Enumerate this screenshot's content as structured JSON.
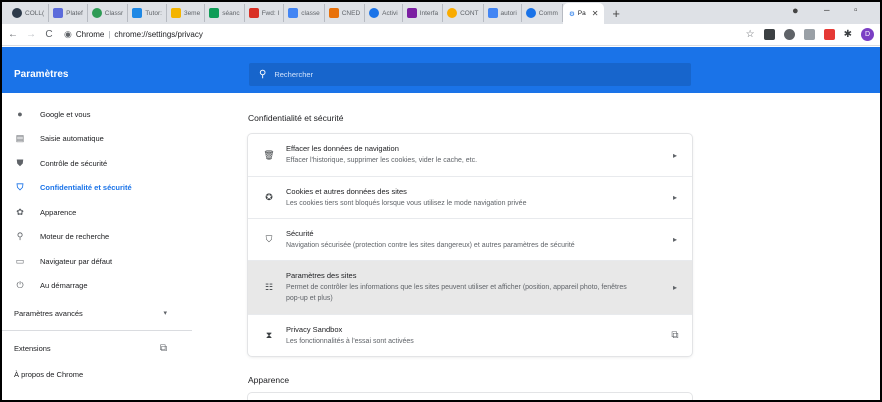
{
  "tabs": [
    {
      "label": "COLL(",
      "color": "#2d3a4a"
    },
    {
      "label": "Platef",
      "color": "#5b6bdb"
    },
    {
      "label": "Classr",
      "color": "#2e9b55"
    },
    {
      "label": "Tutor:",
      "color": "#1e88e5"
    },
    {
      "label": "3eme",
      "color": "#f4b400"
    },
    {
      "label": "séanc",
      "color": "#0f9d58"
    },
    {
      "label": "Fwd: I",
      "color": "#d93025"
    },
    {
      "label": "classe",
      "color": "#4285f4"
    },
    {
      "label": "CNED",
      "color": "#e8710a"
    },
    {
      "label": "Activi",
      "color": "#1a73e8"
    },
    {
      "label": "Interfa",
      "color": "#7b1fa2"
    },
    {
      "label": "CONT",
      "color": "#f9ab00"
    },
    {
      "label": "autori",
      "color": "#4285f4"
    },
    {
      "label": "Comm",
      "color": "#1a73e8"
    }
  ],
  "active_tab": {
    "label": "Pa"
  },
  "address": {
    "site": "Chrome",
    "url": "chrome://settings/privacy"
  },
  "header": {
    "title": "Paramètres",
    "search_placeholder": "Rechercher"
  },
  "profile_initial": "D",
  "sidebar": {
    "items": [
      {
        "label": "Google et vous",
        "icon": "person-icon",
        "glyph": "👤"
      },
      {
        "label": "Saisie automatique",
        "icon": "clipboard-icon",
        "glyph": "▤"
      },
      {
        "label": "Contrôle de sécurité",
        "icon": "shield-check-icon",
        "glyph": "⛊"
      },
      {
        "label": "Confidentialité et sécurité",
        "icon": "shield-icon",
        "glyph": "⛉"
      },
      {
        "label": "Apparence",
        "icon": "palette-icon",
        "glyph": "🎨"
      },
      {
        "label": "Moteur de recherche",
        "icon": "search-icon",
        "glyph": "⚲"
      },
      {
        "label": "Navigateur par défaut",
        "icon": "browser-icon",
        "glyph": "▭"
      },
      {
        "label": "Au démarrage",
        "icon": "power-icon",
        "glyph": "⏻"
      }
    ],
    "advanced": "Paramètres avancés",
    "extensions": "Extensions",
    "about": "À propos de Chrome"
  },
  "privacy": {
    "title": "Confidentialité et sécurité",
    "rows": [
      {
        "title": "Effacer les données de navigation",
        "sub": "Effacer l'historique, supprimer les cookies, vider le cache, etc.",
        "icon": "trash-icon"
      },
      {
        "title": "Cookies et autres données des sites",
        "sub": "Les cookies tiers sont bloqués lorsque vous utilisez le mode navigation privée",
        "icon": "cookie-icon"
      },
      {
        "title": "Sécurité",
        "sub": "Navigation sécurisée (protection contre les sites dangereux) et autres paramètres de sécurité",
        "icon": "shield-icon"
      },
      {
        "title": "Paramètres des sites",
        "sub": "Permet de contrôler les informations que les sites peuvent utiliser et afficher (position, appareil photo, fenêtres pop-up et plus)",
        "icon": "sliders-icon"
      },
      {
        "title": "Privacy Sandbox",
        "sub": "Les fonctionnalités à l'essai sont activées",
        "icon": "flask-icon"
      }
    ]
  },
  "appearance": {
    "title": "Apparence"
  }
}
